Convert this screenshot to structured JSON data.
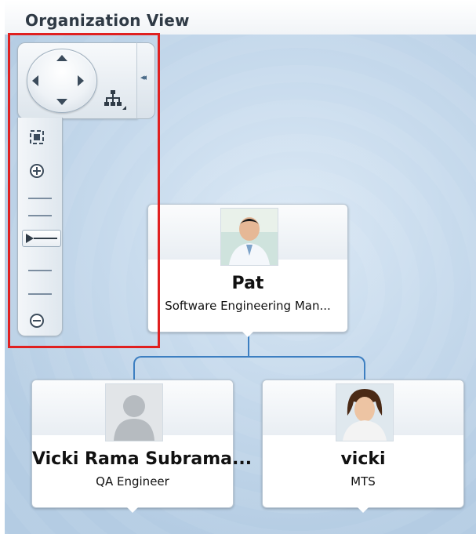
{
  "window": {
    "title": "Organization View"
  },
  "controls": {
    "pan_icons": [
      "arrow-up-icon",
      "arrow-down-icon",
      "arrow-left-icon",
      "arrow-right-icon"
    ],
    "layout_icon": "hierarchy-layout-icon",
    "collapse_icon": "double-chevron-left-icon",
    "zoom_to_fit_icon": "zoom-to-fit-icon",
    "zoom_in_icon": "zoom-in-icon",
    "zoom_out_icon": "zoom-out-icon",
    "zoom_level_index": 2,
    "zoom_level_count": 6,
    "accent_color": "#3d7fc1",
    "highlight_color": "#e02020"
  },
  "nodes": {
    "root": {
      "name": "Pat",
      "title": "Software Engineering Man..."
    },
    "children": [
      {
        "name": "Vicki Rama Subrama...",
        "title": "QA Engineer"
      },
      {
        "name": "vicki",
        "title": "MTS"
      }
    ]
  }
}
